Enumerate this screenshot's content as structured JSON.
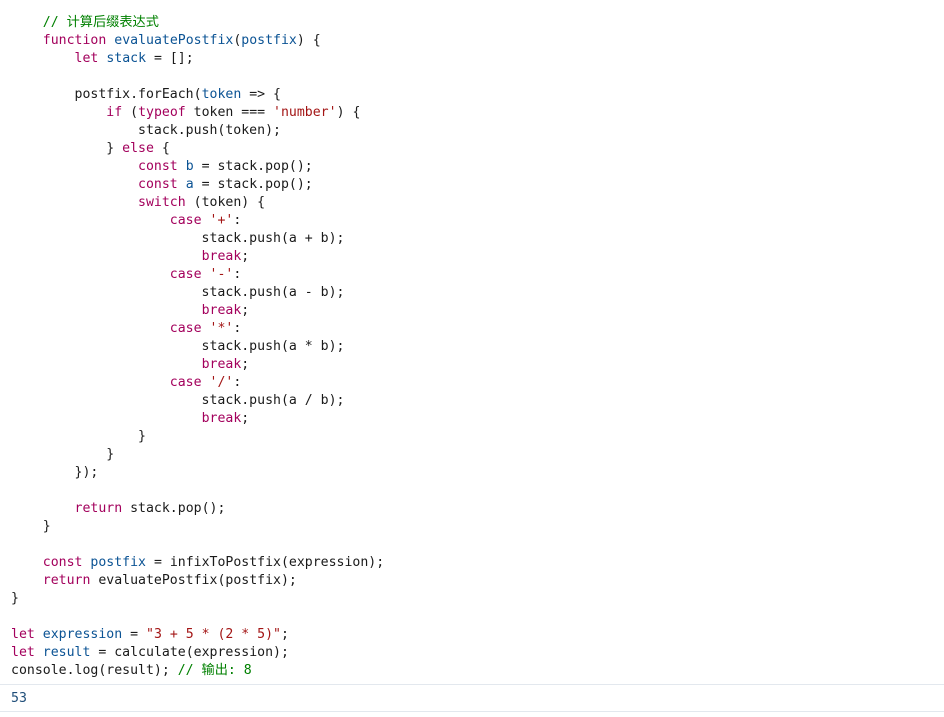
{
  "code_lines": [
    [
      {
        "t": "    "
      },
      {
        "c": "cm",
        "t": "// 计算后缀表达式"
      }
    ],
    [
      {
        "t": "    "
      },
      {
        "c": "kw",
        "t": "function"
      },
      {
        "t": " "
      },
      {
        "c": "id",
        "t": "evaluatePostfix"
      },
      {
        "t": "("
      },
      {
        "c": "id",
        "t": "postfix"
      },
      {
        "t": ") {"
      }
    ],
    [
      {
        "t": "        "
      },
      {
        "c": "kw",
        "t": "let"
      },
      {
        "t": " "
      },
      {
        "c": "id",
        "t": "stack"
      },
      {
        "t": " = [];"
      }
    ],
    [],
    [
      {
        "t": "        postfix.forEach("
      },
      {
        "c": "id",
        "t": "token"
      },
      {
        "t": " => {"
      }
    ],
    [
      {
        "t": "            "
      },
      {
        "c": "kw",
        "t": "if"
      },
      {
        "t": " ("
      },
      {
        "c": "kw",
        "t": "typeof"
      },
      {
        "t": " token === "
      },
      {
        "c": "str",
        "t": "'number'"
      },
      {
        "t": ") {"
      }
    ],
    [
      {
        "t": "                stack.push(token);"
      }
    ],
    [
      {
        "t": "            } "
      },
      {
        "c": "kw",
        "t": "else"
      },
      {
        "t": " {"
      }
    ],
    [
      {
        "t": "                "
      },
      {
        "c": "kw",
        "t": "const"
      },
      {
        "t": " "
      },
      {
        "c": "id",
        "t": "b"
      },
      {
        "t": " = stack.pop();"
      }
    ],
    [
      {
        "t": "                "
      },
      {
        "c": "kw",
        "t": "const"
      },
      {
        "t": " "
      },
      {
        "c": "id",
        "t": "a"
      },
      {
        "t": " = stack.pop();"
      }
    ],
    [
      {
        "t": "                "
      },
      {
        "c": "kw",
        "t": "switch"
      },
      {
        "t": " (token) {"
      }
    ],
    [
      {
        "t": "                    "
      },
      {
        "c": "kw",
        "t": "case"
      },
      {
        "t": " "
      },
      {
        "c": "str",
        "t": "'+'"
      },
      {
        "t": ":"
      }
    ],
    [
      {
        "t": "                        stack.push(a + b);"
      }
    ],
    [
      {
        "t": "                        "
      },
      {
        "c": "kw",
        "t": "break"
      },
      {
        "t": ";"
      }
    ],
    [
      {
        "t": "                    "
      },
      {
        "c": "kw",
        "t": "case"
      },
      {
        "t": " "
      },
      {
        "c": "str",
        "t": "'-'"
      },
      {
        "t": ":"
      }
    ],
    [
      {
        "t": "                        stack.push(a - b);"
      }
    ],
    [
      {
        "t": "                        "
      },
      {
        "c": "kw",
        "t": "break"
      },
      {
        "t": ";"
      }
    ],
    [
      {
        "t": "                    "
      },
      {
        "c": "kw",
        "t": "case"
      },
      {
        "t": " "
      },
      {
        "c": "str",
        "t": "'*'"
      },
      {
        "t": ":"
      }
    ],
    [
      {
        "t": "                        stack.push(a * b);"
      }
    ],
    [
      {
        "t": "                        "
      },
      {
        "c": "kw",
        "t": "break"
      },
      {
        "t": ";"
      }
    ],
    [
      {
        "t": "                    "
      },
      {
        "c": "kw",
        "t": "case"
      },
      {
        "t": " "
      },
      {
        "c": "str",
        "t": "'/'"
      },
      {
        "t": ":"
      }
    ],
    [
      {
        "t": "                        stack.push(a / b);"
      }
    ],
    [
      {
        "t": "                        "
      },
      {
        "c": "kw",
        "t": "break"
      },
      {
        "t": ";"
      }
    ],
    [
      {
        "t": "                }"
      }
    ],
    [
      {
        "t": "            }"
      }
    ],
    [
      {
        "t": "        });"
      }
    ],
    [],
    [
      {
        "t": "        "
      },
      {
        "c": "kw",
        "t": "return"
      },
      {
        "t": " stack.pop();"
      }
    ],
    [
      {
        "t": "    }"
      }
    ],
    [],
    [
      {
        "t": "    "
      },
      {
        "c": "kw",
        "t": "const"
      },
      {
        "t": " "
      },
      {
        "c": "id",
        "t": "postfix"
      },
      {
        "t": " = infixToPostfix(expression);"
      }
    ],
    [
      {
        "t": "    "
      },
      {
        "c": "kw",
        "t": "return"
      },
      {
        "t": " evaluatePostfix(postfix);"
      }
    ],
    [
      {
        "t": "}"
      }
    ],
    [],
    [
      {
        "c": "kw",
        "t": "let"
      },
      {
        "t": " "
      },
      {
        "c": "id",
        "t": "expression"
      },
      {
        "t": " = "
      },
      {
        "c": "str",
        "t": "\"3 + 5 * (2 * 5)\""
      },
      {
        "t": ";"
      }
    ],
    [
      {
        "c": "kw",
        "t": "let"
      },
      {
        "t": " "
      },
      {
        "c": "id",
        "t": "result"
      },
      {
        "t": " = calculate(expression);"
      }
    ],
    [
      {
        "t": "console.log(result); "
      },
      {
        "c": "cm",
        "t": "// 输出: 8"
      }
    ]
  ],
  "output": {
    "value": "53"
  },
  "colors": {
    "keyword": "#a3005c",
    "identifier": "#0b5394",
    "string": "#a31515",
    "comment": "#008000",
    "output": "#1f4e79"
  }
}
